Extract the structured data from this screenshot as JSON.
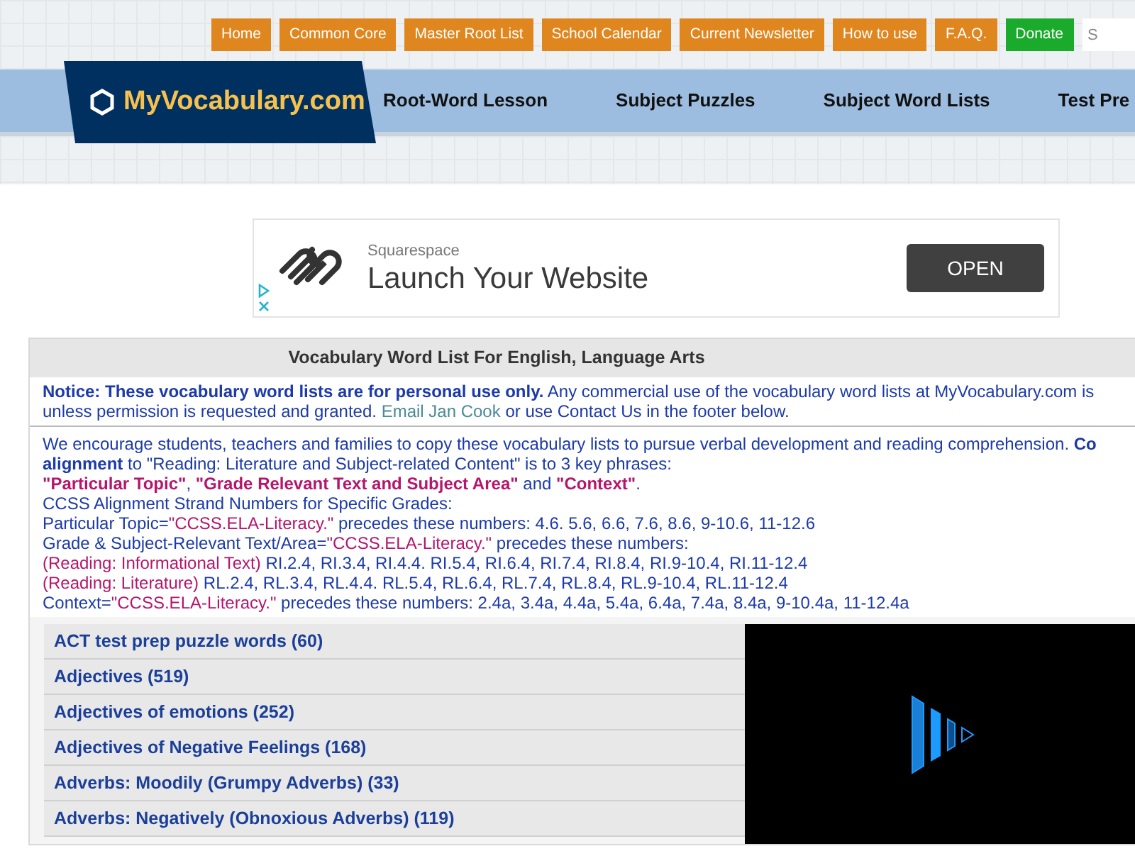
{
  "top_menu": [
    {
      "label": "Home",
      "kind": "link"
    },
    {
      "label": "Common Core",
      "kind": "link"
    },
    {
      "label": "Master Root List",
      "kind": "link"
    },
    {
      "label": "School Calendar",
      "kind": "link"
    },
    {
      "label": "Current Newsletter",
      "kind": "link"
    },
    {
      "label": "How to use",
      "kind": "link"
    },
    {
      "label": "F.A.Q.",
      "kind": "link"
    },
    {
      "label": "Donate",
      "kind": "donate"
    }
  ],
  "search": {
    "placeholder": "S"
  },
  "logo": {
    "text": "MyVocabulary.com"
  },
  "nav": [
    "Root-Word Lesson",
    "Subject Puzzles",
    "Subject Word Lists",
    "Test Pre"
  ],
  "ad": {
    "brand": "Squarespace",
    "headline": "Launch Your Website",
    "button": "OPEN"
  },
  "panel": {
    "title": "Vocabulary Word List For English, Language Arts",
    "notice": [
      [
        {
          "text": "Notice: These vocabulary word lists are for personal use only.",
          "kind": "bold"
        },
        {
          "text": " Any commercial use of the vocabulary word lists at MyVocabulary.com is",
          "kind": "plain"
        }
      ],
      [
        {
          "text": "unless permission is requested and granted. ",
          "kind": "plain"
        },
        {
          "text": "Email Jan Cook",
          "kind": "link"
        },
        {
          "text": " or use Contact Us in the footer below.",
          "kind": "plain"
        }
      ]
    ],
    "info": [
      [
        {
          "text": "We encourage students, teachers and families to copy these vocabulary lists to pursue verbal development and reading comprehension. ",
          "kind": "plain"
        },
        {
          "text": "Co",
          "kind": "bold"
        }
      ],
      [
        {
          "text": "alignment",
          "kind": "bold"
        },
        {
          "text": " to \"Reading: Literature and Subject-related Content\" is to 3 key phrases:",
          "kind": "plain"
        }
      ],
      [
        {
          "text": "\"Particular Topic\"",
          "kind": "accent-bold"
        },
        {
          "text": ", ",
          "kind": "plain"
        },
        {
          "text": "\"Grade Relevant Text and Subject Area\"",
          "kind": "accent-bold"
        },
        {
          "text": " and ",
          "kind": "plain"
        },
        {
          "text": "\"Context\"",
          "kind": "accent-bold"
        },
        {
          "text": ".",
          "kind": "plain"
        }
      ],
      [
        {
          "text": "CCSS Alignment Strand Numbers for Specific Grades:",
          "kind": "plain"
        }
      ],
      [
        {
          "text": "Particular Topic=",
          "kind": "plain"
        },
        {
          "text": "\"CCSS.ELA-Literacy.\"",
          "kind": "accent"
        },
        {
          "text": " precedes these numbers: 4.6. 5.6, 6.6, 7.6, 8.6, 9-10.6, 11-12.6",
          "kind": "plain"
        }
      ],
      [
        {
          "text": "Grade & Subject-Relevant Text/Area=",
          "kind": "plain"
        },
        {
          "text": "\"CCSS.ELA-Literacy.\"",
          "kind": "accent"
        },
        {
          "text": " precedes these numbers:",
          "kind": "plain"
        }
      ],
      [
        {
          "text": "(Reading: Informational Text)",
          "kind": "accent"
        },
        {
          "text": " RI.2.4, RI.3.4, RI.4.4. RI.5.4, RI.6.4, RI.7.4, RI.8.4, RI.9-10.4, RI.11-12.4",
          "kind": "plain"
        }
      ],
      [
        {
          "text": "(Reading: Literature)",
          "kind": "accent"
        },
        {
          "text": " RL.2.4, RL.3.4, RL.4.4. RL.5.4, RL.6.4, RL.7.4, RL.8.4, RL.9-10.4, RL.11-12.4",
          "kind": "plain"
        }
      ],
      [
        {
          "text": "Context=",
          "kind": "plain"
        },
        {
          "text": "\"CCSS.ELA-Literacy.\"",
          "kind": "accent"
        },
        {
          "text": " precedes these numbers: 2.4a, 3.4a, 4.4a, 5.4a, 6.4a, 7.4a, 8.4a, 9-10.4a, 11-12.4a",
          "kind": "plain"
        }
      ]
    ]
  },
  "word_lists": [
    "ACT test prep puzzle words (60)",
    "Adjectives (519)",
    "Adjectives of emotions (252)",
    "Adjectives of Negative Feelings (168)",
    "Adverbs: Moodily (Grumpy Adverbs) (33)",
    "Adverbs: Negatively (Obnoxious Adverbs) (119)"
  ]
}
